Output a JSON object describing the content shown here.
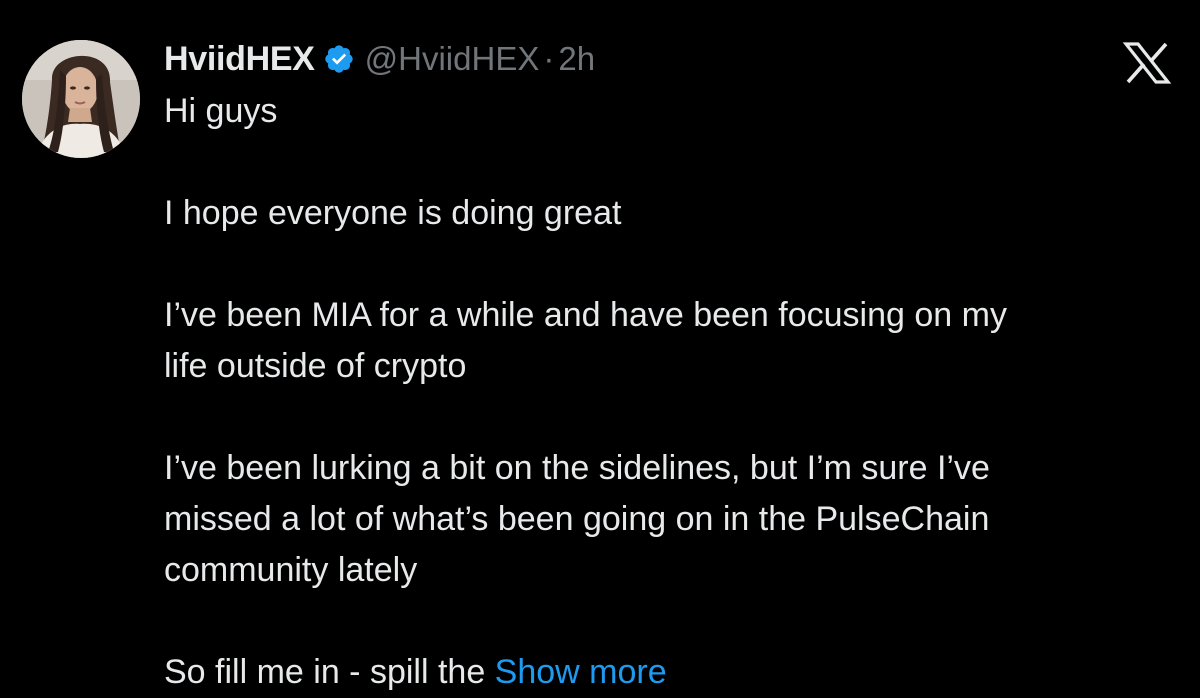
{
  "tweet": {
    "author": {
      "display_name": "HviidHEX",
      "handle": "@HviidHEX",
      "separator": "·",
      "timestamp": "2h",
      "verified_icon": "verified-badge-icon",
      "avatar": "profile-photo"
    },
    "body": {
      "line1": "Hi guys",
      "line2": "I hope everyone is doing great",
      "line3": "I’ve been MIA for a while and have been focusing on my",
      "line4": "life outside of crypto",
      "line5": "I’ve been lurking a bit on the sidelines, but I’m sure I’ve",
      "line6": "missed a lot of what’s been going on in the PulseChain",
      "line7": "community lately",
      "line8": "So fill me in - spill the "
    },
    "show_more_label": "Show more",
    "close_icon": "x-logo-icon"
  },
  "colors": {
    "background": "#000000",
    "text_primary": "#e7e9ea",
    "text_secondary": "#71767b",
    "link": "#1d9bf0",
    "verified": "#1d9bf0"
  }
}
